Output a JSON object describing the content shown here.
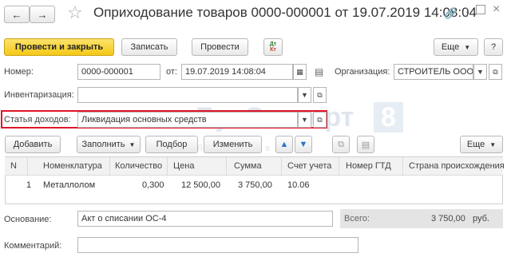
{
  "header": {
    "title": "Оприходование товаров 0000-000001 от 19.07.2019 14:08:04"
  },
  "toolbar": {
    "post_close": "Провести и закрыть",
    "save": "Записать",
    "post": "Провести",
    "dtkt_top": "Дт",
    "dtkt_bottom": "Кт",
    "more": "Еще"
  },
  "form": {
    "number_label": "Номер:",
    "number_value": "0000-000001",
    "from_label": "от:",
    "date_value": "19.07.2019 14:08:04",
    "org_label": "Организация:",
    "org_value": "СТРОИТЕЛЬ ООО",
    "inventory_label": "Инвентаризация:",
    "inventory_value": "",
    "income_label": "Статья доходов:",
    "income_value": "Ликвидация основных средств"
  },
  "table_toolbar": {
    "add": "Добавить",
    "fill": "Заполнить",
    "select": "Подбор",
    "change": "Изменить",
    "more": "Еще"
  },
  "table": {
    "columns": [
      "N",
      "Номенклатура",
      "Количество",
      "Цена",
      "Сумма",
      "Счет учета",
      "Номер ГТД",
      "Страна происхождения"
    ],
    "rows": [
      [
        "1",
        "Металлолом",
        "0,300",
        "12 500,00",
        "3 750,00",
        "10.06",
        "",
        ""
      ]
    ]
  },
  "footer": {
    "basis_label": "Основание:",
    "basis_value": "Акт о списании ОС-4",
    "total_label": "Всего:",
    "total_value": "3 750,00",
    "currency": "руб.",
    "comment_label": "Комментарий:",
    "comment_value": ""
  },
  "watermark": {
    "main": "БухЭксперт",
    "digit": "8",
    "sub": "за бухгалтерией в 1С"
  }
}
